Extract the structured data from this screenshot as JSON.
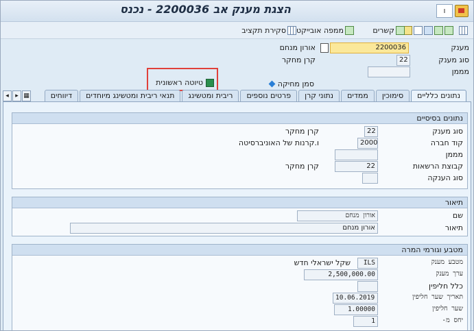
{
  "window": {
    "title": "הצגת מענק אב 2200036 - נכנס",
    "menu_label": "ו"
  },
  "toolbar": {
    "items": [
      {
        "label": "סקירת תקציב",
        "icon": "budget-overview-icon"
      },
      {
        "label": "ממפה אובייקט",
        "icon": "object-mapper-icon"
      },
      {
        "label": "קשרים",
        "icon": "relationships-icon"
      }
    ]
  },
  "header": {
    "grant_label": "מענק",
    "grant_value": "2200036",
    "grant_desc_label": "אורון מנחם",
    "grant_type_label": "סוג מענק",
    "grant_type_value": "22",
    "grant_type_desc": "קרן מחקר",
    "sponsor_label": "מממן",
    "sponsor_value": "",
    "lock_label": "סמן מחיקה",
    "draft_label": "טיוטה ראשונית"
  },
  "tabs": [
    {
      "label": "נתונים כלליים",
      "active": true
    },
    {
      "label": "סימוכין"
    },
    {
      "label": "ממדים"
    },
    {
      "label": "נתוני קרן"
    },
    {
      "label": "פרטים נוספים"
    },
    {
      "label": "ריבית ומטשינג"
    },
    {
      "label": "תנאי ריבית ומטשינג מיוחדים"
    },
    {
      "label": "דיווחים"
    }
  ],
  "basic": {
    "title": "נתונים בסיסיים",
    "grant_type_label": "סוג מענק",
    "grant_type_value": "22",
    "grant_type_desc": "קרן מחקר",
    "company_code_label": "קוד חברה",
    "company_code_value": "2000",
    "company_code_desc": "ו.קרנות של האוניברסיטה",
    "sponsor_label": "מממן",
    "sponsor_value": "",
    "auth_group_label": "קבוצת הרשאות",
    "auth_group_value": "22",
    "auth_group_desc": "קרן מחקר",
    "award_type_label": "סוג הענקה",
    "award_type_value": ""
  },
  "description": {
    "title": "תיאור",
    "name_label": "שם",
    "name_value": "אורון מנחם",
    "desc_label": "תיאור",
    "desc_value": "אורון מנחם"
  },
  "currency": {
    "title": "מטבע וגורמי המרה",
    "currency_label": "מטבע מענק",
    "currency_value": "ILS",
    "currency_desc": "שקל ישראלי חדש",
    "value_label": "ערך מענק",
    "value_value": "2,500,000.00",
    "rule_label": "כלל חליפין",
    "rule_value": "",
    "rate_date_label": "תאריך שער חליפין",
    "rate_date_value": "10.06.2019",
    "rate_label": "שער חליפין",
    "rate_value": "1.00000",
    "ratio_label": "יחס מ-",
    "ratio_value": "1"
  }
}
